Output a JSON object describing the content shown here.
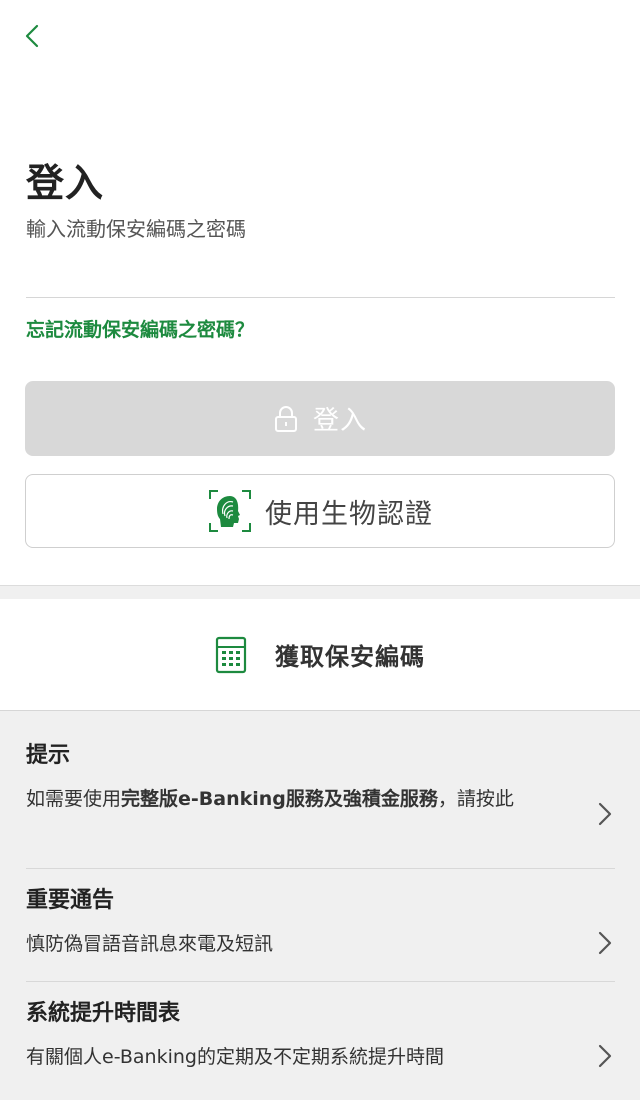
{
  "header": {
    "back_icon": "chevron-left-icon"
  },
  "login": {
    "title": "登入",
    "subtitle": "輸入流動保安編碼之密碼",
    "password_value": "",
    "forgot_link": "忘記流動保安編碼之密碼？",
    "login_button": "登入",
    "login_button_icon": "lock-icon",
    "biometric_button": "使用生物認證",
    "biometric_icon": "fingerprint-face-icon"
  },
  "token": {
    "label": "獲取保安編碼",
    "icon": "calculator-icon"
  },
  "info": {
    "tip": {
      "title": "提示",
      "desc_pre": "如需要使用",
      "desc_bold": "完整版e-Banking服務及強積金服務",
      "desc_post": "，請按此"
    },
    "notice": {
      "title": "重要通告",
      "desc": "慎防偽冒語音訊息來電及短訊"
    },
    "schedule": {
      "title": "系統提升時間表",
      "desc": "有關個人e-Banking的定期及不定期系統提升時間"
    }
  },
  "colors": {
    "accent": "#1d8a3f",
    "disabled_button": "#d8d8d8",
    "panel_bg": "#f0f0f0"
  }
}
